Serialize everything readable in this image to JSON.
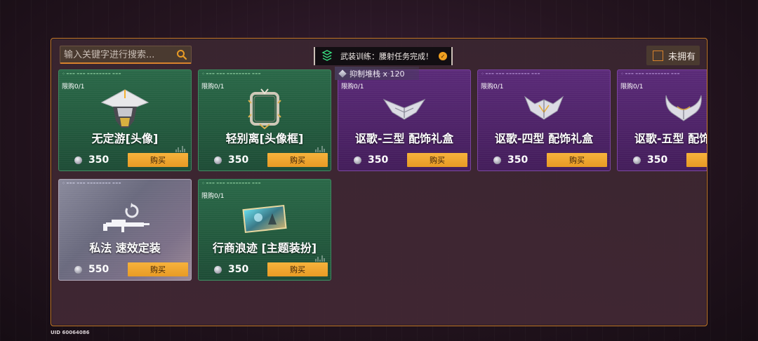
{
  "search": {
    "placeholder": "输入关键字进行搜索..."
  },
  "notice": {
    "text": "武装训练：腰射任务完成！"
  },
  "filter": {
    "label": "未拥有"
  },
  "tooltip": {
    "text": "抑制堆栈 x 120"
  },
  "items": [
    {
      "name": "无定游[头像]",
      "limit": "限购0/1",
      "price": "350",
      "buy_label": "购买",
      "rarity": "green",
      "icon": "hat-avatar-icon"
    },
    {
      "name": "轻别离[头像框]",
      "limit": "限购0/1",
      "price": "350",
      "buy_label": "购买",
      "rarity": "green",
      "icon": "avatar-frame-icon"
    },
    {
      "name": "讴歌-三型 配饰礼盒",
      "limit": "限购0/1",
      "price": "350",
      "buy_label": "购买",
      "rarity": "purple",
      "icon": "wing-emblem-icon"
    },
    {
      "name": "讴歌-四型 配饰礼盒",
      "limit": "限购0/1",
      "price": "350",
      "buy_label": "购买",
      "rarity": "purple",
      "icon": "wing-emblem-icon"
    },
    {
      "name": "讴歌-五型 配饰礼盒",
      "limit": "限购0/1",
      "price": "350",
      "buy_label": "购买",
      "rarity": "purple",
      "icon": "wing-emblem-icon"
    },
    {
      "name": "私法 速效定装",
      "limit": "",
      "price": "550",
      "buy_label": "购买",
      "rarity": "grey",
      "icon": "rifle-icon"
    },
    {
      "name": "行商浪迹 [主题装扮]",
      "limit": "限购0/1",
      "price": "350",
      "buy_label": "购买",
      "rarity": "green",
      "icon": "theme-card-icon"
    }
  ],
  "footer": {
    "uid": "UID 60064086"
  },
  "colors": {
    "accent": "#d8822c",
    "buy_button": "#f0a52e",
    "green_card": "#235a3e",
    "purple_card": "#4e2368"
  }
}
